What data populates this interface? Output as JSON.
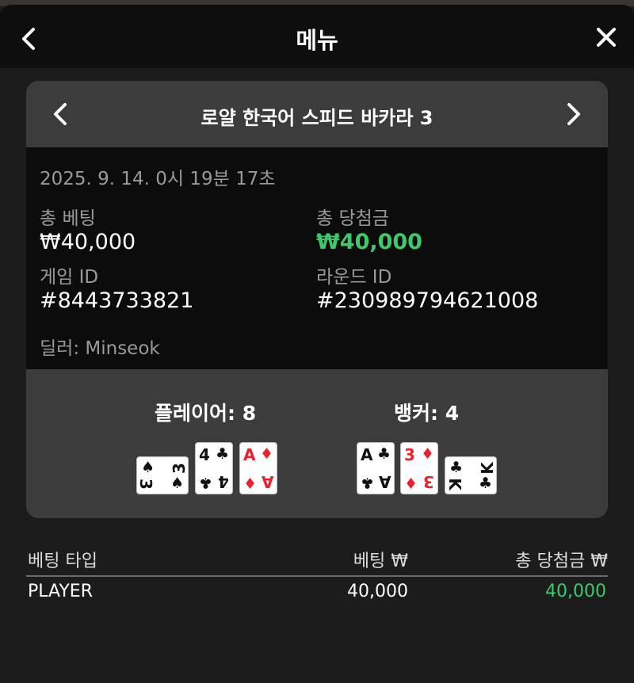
{
  "header": {
    "title": "메뉴"
  },
  "round": {
    "game_title": "로얄 한국어 스피드 바카라 3",
    "datetime": "2025. 9. 14. 0시 19분 17초",
    "total_bet_label": "총 베팅",
    "total_bet_value": "₩40,000",
    "total_win_label": "총 당첨금",
    "total_win_value": "₩40,000",
    "game_id_label": "게임 ID",
    "game_id_value": "#8443733821",
    "round_id_label": "라운드 ID",
    "round_id_value": "#230989794621008",
    "dealer": "딜러: Minseok"
  },
  "hands": {
    "player_label": "플레이어: 8",
    "banker_label": "뱅커: 4",
    "player_cards": [
      {
        "rank": "3",
        "suit": "♠",
        "color": "#111111"
      },
      {
        "rank": "4",
        "suit": "♣",
        "color": "#111111"
      },
      {
        "rank": "A",
        "suit": "♦",
        "color": "#e8212b"
      }
    ],
    "banker_cards": [
      {
        "rank": "A",
        "suit": "♣",
        "color": "#111111"
      },
      {
        "rank": "3",
        "suit": "♦",
        "color": "#e8212b"
      },
      {
        "rank": "K",
        "suit": "♣",
        "color": "#111111"
      }
    ]
  },
  "bets_table": {
    "col_type": "베팅 타입",
    "col_bet": "베팅 ₩",
    "col_win": "총 당첨금 ₩",
    "rows": [
      {
        "type": "PLAYER",
        "bet": "40,000",
        "win": "40,000"
      }
    ]
  },
  "colors": {
    "win_green": "#3ec96a",
    "card_red": "#e8212b"
  }
}
